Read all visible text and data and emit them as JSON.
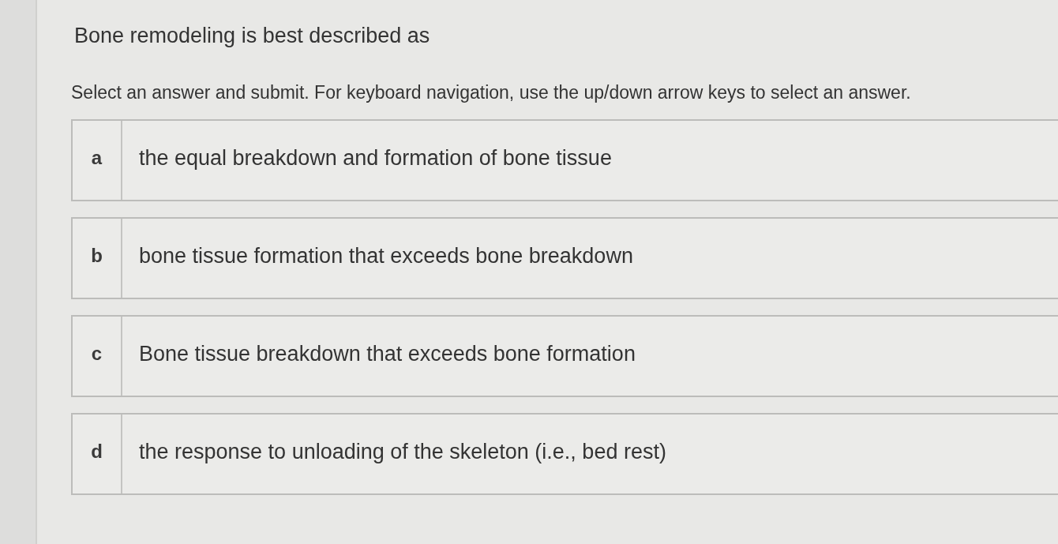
{
  "question": "Bone remodeling is best described as",
  "instructions": "Select an answer and submit. For keyboard navigation, use the up/down arrow keys to select an answer.",
  "options": [
    {
      "letter": "a",
      "text": "the equal breakdown and formation of bone tissue",
      "selected": false
    },
    {
      "letter": "b",
      "text": "bone tissue formation that exceeds bone breakdown",
      "selected": false
    },
    {
      "letter": "c",
      "text": "Bone tissue breakdown that exceeds bone formation",
      "selected": false
    },
    {
      "letter": "d",
      "text": "the response to unloading of the skeleton (i.e., bed rest)",
      "selected": false
    }
  ]
}
